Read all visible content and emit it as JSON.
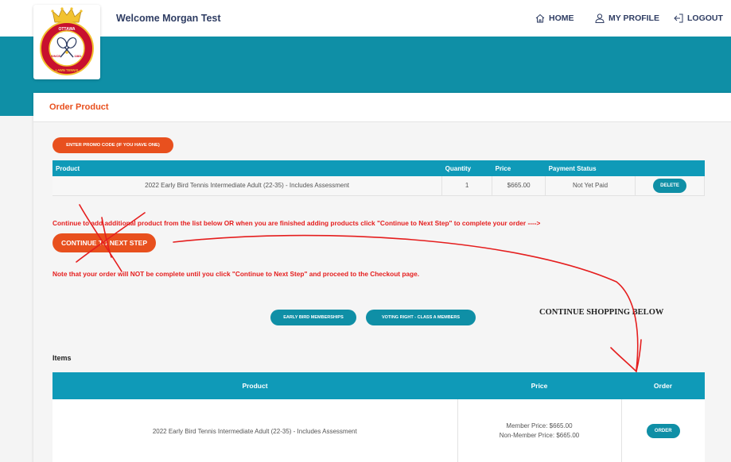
{
  "header": {
    "welcome": "Welcome Morgan Test",
    "nav": [
      {
        "label": "HOME",
        "icon": "home-icon"
      },
      {
        "label": "MY PROFILE",
        "icon": "user-icon"
      },
      {
        "label": "LOGOUT",
        "icon": "logout-icon"
      }
    ]
  },
  "logo": {
    "top_text": "OTTAWA",
    "left_text": "SINCE",
    "right_text": "1881",
    "bottom_text": "LAWN TENNIS"
  },
  "page": {
    "title": "Order Product"
  },
  "promo_button": "ENTER PROMO CODE (IF YOU HAVE ONE)",
  "order_table": {
    "headers": [
      "Product",
      "Quantity",
      "Price",
      "Payment Status",
      ""
    ],
    "rows": [
      {
        "product": "2022 Early Bird Tennis Intermediate Adult (22-35) - Includes Assessment",
        "quantity": "1",
        "price": "$665.00",
        "status": "Not Yet Paid",
        "action": "DELETE"
      }
    ]
  },
  "messages": {
    "continue": "Continue to add additional product from the list below OR when you are finished adding products click \"Continue to Next Step\" to complete your order ---->",
    "note": "Note that your order will NOT be complete until you click \"Continue to Next Step\" and proceed to the Checkout page."
  },
  "next_button": "CONTINUE TO NEXT STEP",
  "category_buttons": [
    "EARLY BIRD MEMBERSHIPS",
    "VOTING RIGHT - CLASS A MEMBERS"
  ],
  "continue_shopping": "CONTINUE SHOPPING BELOW",
  "items": {
    "label": "Items",
    "headers": [
      "Product",
      "Price",
      "Order"
    ],
    "rows": [
      {
        "product": "2022 Early Bird Tennis Intermediate Adult (22-35) - Includes Assessment",
        "member_price": "Member Price: $665.00",
        "non_member_price": "Non-Member Price: $665.00",
        "action": "ORDER"
      }
    ]
  },
  "colors": {
    "accent": "#e8501e",
    "brand": "#0f8fa6",
    "annotation": "#e51e1e",
    "header_text": "#2f3d63"
  }
}
